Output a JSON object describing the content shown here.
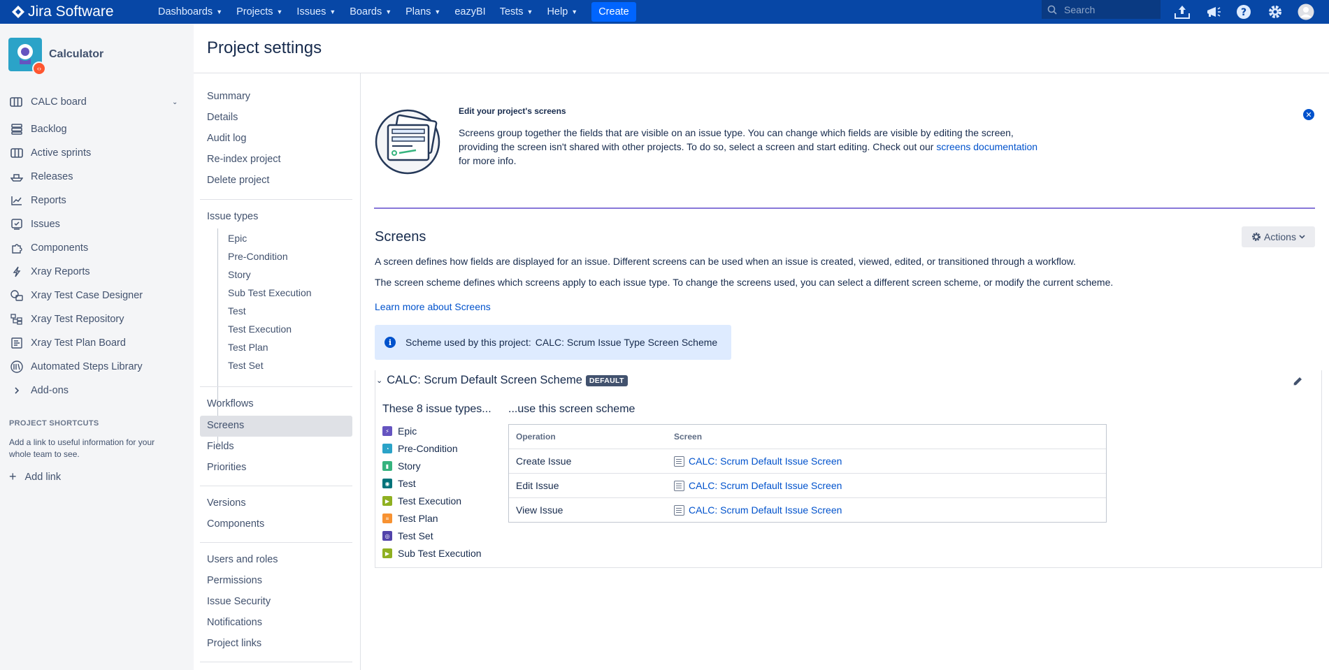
{
  "topnav": {
    "app_name": "Jira Software",
    "items": [
      "Dashboards",
      "Projects",
      "Issues",
      "Boards",
      "Plans",
      "eazyBI",
      "Tests",
      "Help"
    ],
    "create_label": "Create",
    "search_placeholder": "Search"
  },
  "sidebar": {
    "project_name": "Calculator",
    "board_label": "CALC board",
    "items": [
      {
        "label": "Backlog",
        "icon": "backlog-icon"
      },
      {
        "label": "Active sprints",
        "icon": "board-icon"
      },
      {
        "label": "Releases",
        "icon": "ship-icon"
      },
      {
        "label": "Reports",
        "icon": "chart-icon"
      },
      {
        "label": "Issues",
        "icon": "issues-icon"
      },
      {
        "label": "Components",
        "icon": "puzzle-icon"
      },
      {
        "label": "Xray Reports",
        "icon": "lightning-icon"
      },
      {
        "label": "Xray Test Case Designer",
        "icon": "designer-icon"
      },
      {
        "label": "Xray Test Repository",
        "icon": "repository-icon"
      },
      {
        "label": "Xray Test Plan Board",
        "icon": "plan-board-icon"
      },
      {
        "label": "Automated Steps Library",
        "icon": "library-icon"
      },
      {
        "label": "Add-ons",
        "icon": "chevron-right-icon"
      }
    ],
    "shortcuts_title": "PROJECT SHORTCUTS",
    "shortcuts_desc": "Add a link to useful information for your whole team to see.",
    "add_link": "Add link"
  },
  "page": {
    "title": "Project settings"
  },
  "settings_nav": {
    "group1": [
      "Summary",
      "Details",
      "Audit log",
      "Re-index project",
      "Delete project"
    ],
    "issue_types_label": "Issue types",
    "issue_types": [
      "Epic",
      "Pre-Condition",
      "Story",
      "Sub Test Execution",
      "Test",
      "Test Execution",
      "Test Plan",
      "Test Set"
    ],
    "group3": [
      "Workflows",
      "Screens",
      "Fields",
      "Priorities"
    ],
    "group4": [
      "Versions",
      "Components"
    ],
    "group5": [
      "Users and roles",
      "Permissions",
      "Issue Security",
      "Notifications",
      "Project links"
    ]
  },
  "intro": {
    "title": "Edit your project's screens",
    "text_before": "Screens group together the fields that are visible on an issue type. You can change which fields are visible by editing the screen, providing the screen isn't shared with other projects. To do so, select a screen and start editing. Check out our ",
    "link": "screens documentation",
    "text_after": " for more info."
  },
  "screens": {
    "heading": "Screens",
    "actions_label": "Actions",
    "desc1": "A screen defines how fields are displayed for an issue. Different screens can be used when an issue is created, viewed, edited, or transitioned through a workflow.",
    "desc2": "The screen scheme defines which screens apply to each issue type. To change the screens used, you can select a different screen scheme, or modify the current scheme.",
    "learn_more": "Learn more about Screens",
    "scheme_label": "Scheme used by this project:",
    "scheme_value": "CALC: Scrum Issue Type Screen Scheme",
    "scheme_name": "CALC: Scrum Default Screen Scheme",
    "scheme_badge": "DEFAULT",
    "col1_heading": "These 8 issue types...",
    "col2_heading": "...use this screen scheme",
    "issue_types": [
      {
        "label": "Epic",
        "color": "#6554c0"
      },
      {
        "label": "Pre-Condition",
        "color": "#2ba3c8"
      },
      {
        "label": "Story",
        "color": "#36b37e"
      },
      {
        "label": "Test",
        "color": "#00737a"
      },
      {
        "label": "Test Execution",
        "color": "#8fb021"
      },
      {
        "label": "Test Plan",
        "color": "#f79232"
      },
      {
        "label": "Test Set",
        "color": "#5243aa"
      },
      {
        "label": "Sub Test Execution",
        "color": "#8fb021"
      }
    ],
    "table_headers": [
      "Operation",
      "Screen"
    ],
    "rows": [
      {
        "operation": "Create Issue",
        "screen": "CALC: Scrum Default Issue Screen"
      },
      {
        "operation": "Edit Issue",
        "screen": "CALC: Scrum Default Issue Screen"
      },
      {
        "operation": "View Issue",
        "screen": "CALC: Scrum Default Issue Screen"
      }
    ]
  }
}
